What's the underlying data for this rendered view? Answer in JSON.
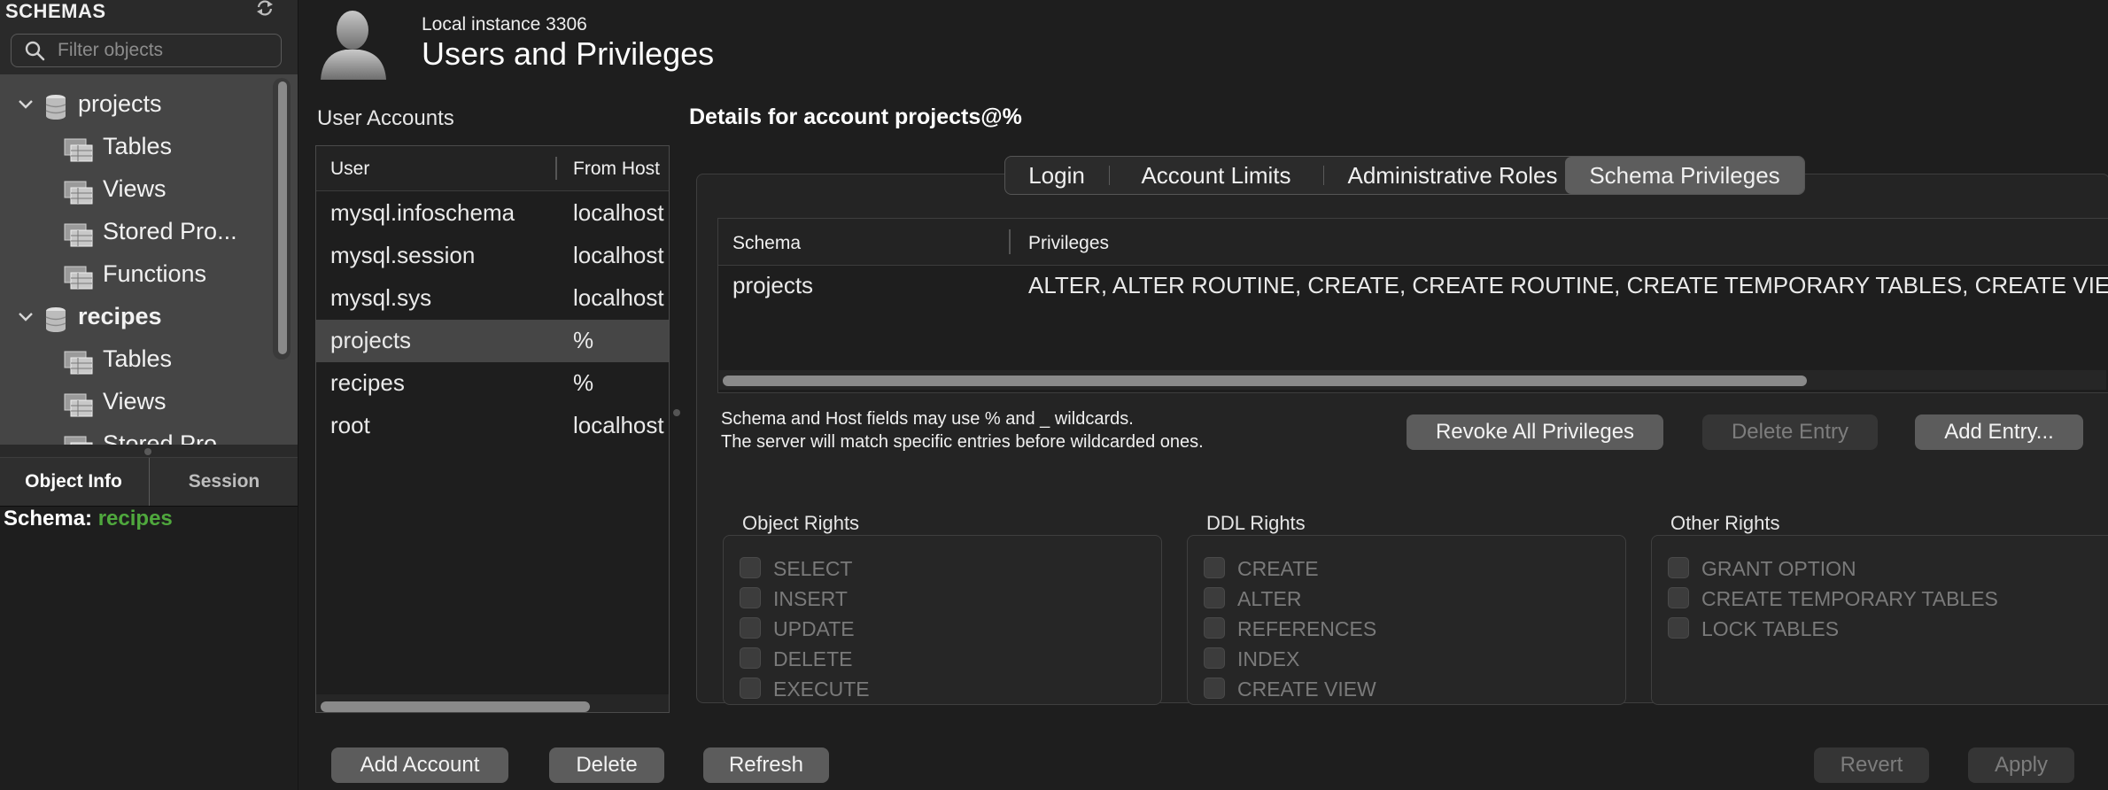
{
  "sidebar": {
    "title": "SCHEMAS",
    "filter_placeholder": "Filter objects",
    "tree": [
      {
        "label": "projects",
        "type": "schema"
      },
      {
        "label": "Tables",
        "type": "folder"
      },
      {
        "label": "Views",
        "type": "folder"
      },
      {
        "label": "Stored Pro...",
        "type": "folder"
      },
      {
        "label": "Functions",
        "type": "folder"
      },
      {
        "label": "recipes",
        "type": "schema"
      },
      {
        "label": "Tables",
        "type": "folder"
      },
      {
        "label": "Views",
        "type": "folder"
      },
      {
        "label": "Stored Pro...",
        "type": "folder"
      }
    ],
    "tabs": {
      "object_info": "Object Info",
      "session": "Session"
    },
    "info": {
      "schema_label": "Schema:",
      "schema_value": "recipes"
    }
  },
  "header": {
    "instance": "Local instance 3306",
    "title": "Users and Privileges"
  },
  "accounts": {
    "label": "User Accounts",
    "columns": [
      "User",
      "From Host"
    ],
    "rows": [
      {
        "user": "mysql.infoschema",
        "host": "localhost"
      },
      {
        "user": "mysql.session",
        "host": "localhost"
      },
      {
        "user": "mysql.sys",
        "host": "localhost"
      },
      {
        "user": "projects",
        "host": "%"
      },
      {
        "user": "recipes",
        "host": "%"
      },
      {
        "user": "root",
        "host": "localhost"
      }
    ],
    "selected": "projects"
  },
  "details": {
    "title": "Details for account projects@%",
    "tabs": [
      "Login",
      "Account Limits",
      "Administrative Roles",
      "Schema Privileges"
    ],
    "active_tab": "Schema Privileges",
    "table": {
      "columns": [
        "Schema",
        "Privileges"
      ],
      "rows": [
        {
          "schema": "projects",
          "privileges": "ALTER, ALTER ROUTINE, CREATE, CREATE ROUTINE, CREATE TEMPORARY TABLES, CREATE VIEW, DELETE, DROP, EVENT"
        }
      ]
    },
    "note_line1": "Schema and Host fields may use % and _ wildcards.",
    "note_line2": "The server will match specific entries before wildcarded ones.",
    "buttons": {
      "revoke_all": "Revoke All Privileges",
      "delete_entry": "Delete Entry",
      "add_entry": "Add Entry..."
    },
    "groups": {
      "object_rights": {
        "label": "Object Rights",
        "items": [
          "SELECT",
          "INSERT",
          "UPDATE",
          "DELETE",
          "EXECUTE"
        ]
      },
      "ddl_rights": {
        "label": "DDL Rights",
        "items": [
          "CREATE",
          "ALTER",
          "REFERENCES",
          "INDEX",
          "CREATE VIEW"
        ]
      },
      "other_rights": {
        "label": "Other Rights",
        "items": [
          "GRANT OPTION",
          "CREATE TEMPORARY TABLES",
          "LOCK TABLES"
        ]
      }
    }
  },
  "footer": {
    "add_account": "Add Account",
    "delete": "Delete",
    "refresh": "Refresh",
    "revert": "Revert",
    "apply": "Apply"
  },
  "colors": {
    "accent_green": "#4fa83d",
    "selected_row": "#464646",
    "active_tab": "#5d5d5d"
  }
}
